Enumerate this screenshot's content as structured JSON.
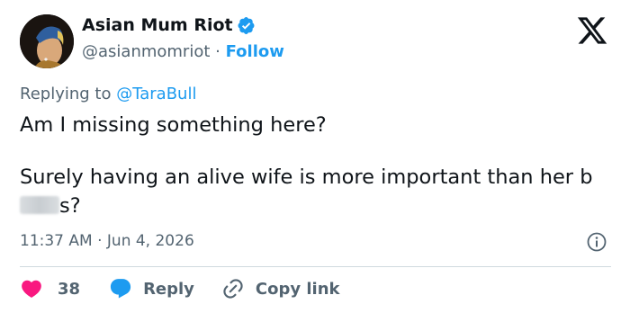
{
  "author": {
    "display_name": "Asian Mum Riot",
    "handle": "@asianmomriot",
    "separator": "·",
    "follow_label": "Follow",
    "avatar_icon": "avatar-portrait-icon",
    "verified_icon": "verified-badge-icon"
  },
  "reply_context": {
    "prefix": "Replying to",
    "mention": "@TaraBull"
  },
  "tweet": {
    "line1": "Am I missing something here?",
    "line2_part1": "Surely having an alive wife is more important than her b",
    "line2_part2": "s?"
  },
  "meta": {
    "timestamp": "11:37 AM · Jun 4, 2026"
  },
  "actions": {
    "like_count": "38",
    "reply_label": "Reply",
    "copy_link_label": "Copy link"
  },
  "colors": {
    "accent": "#1d9bf0",
    "like": "#f91880",
    "text": "#0f1419",
    "secondary": "#536471"
  }
}
